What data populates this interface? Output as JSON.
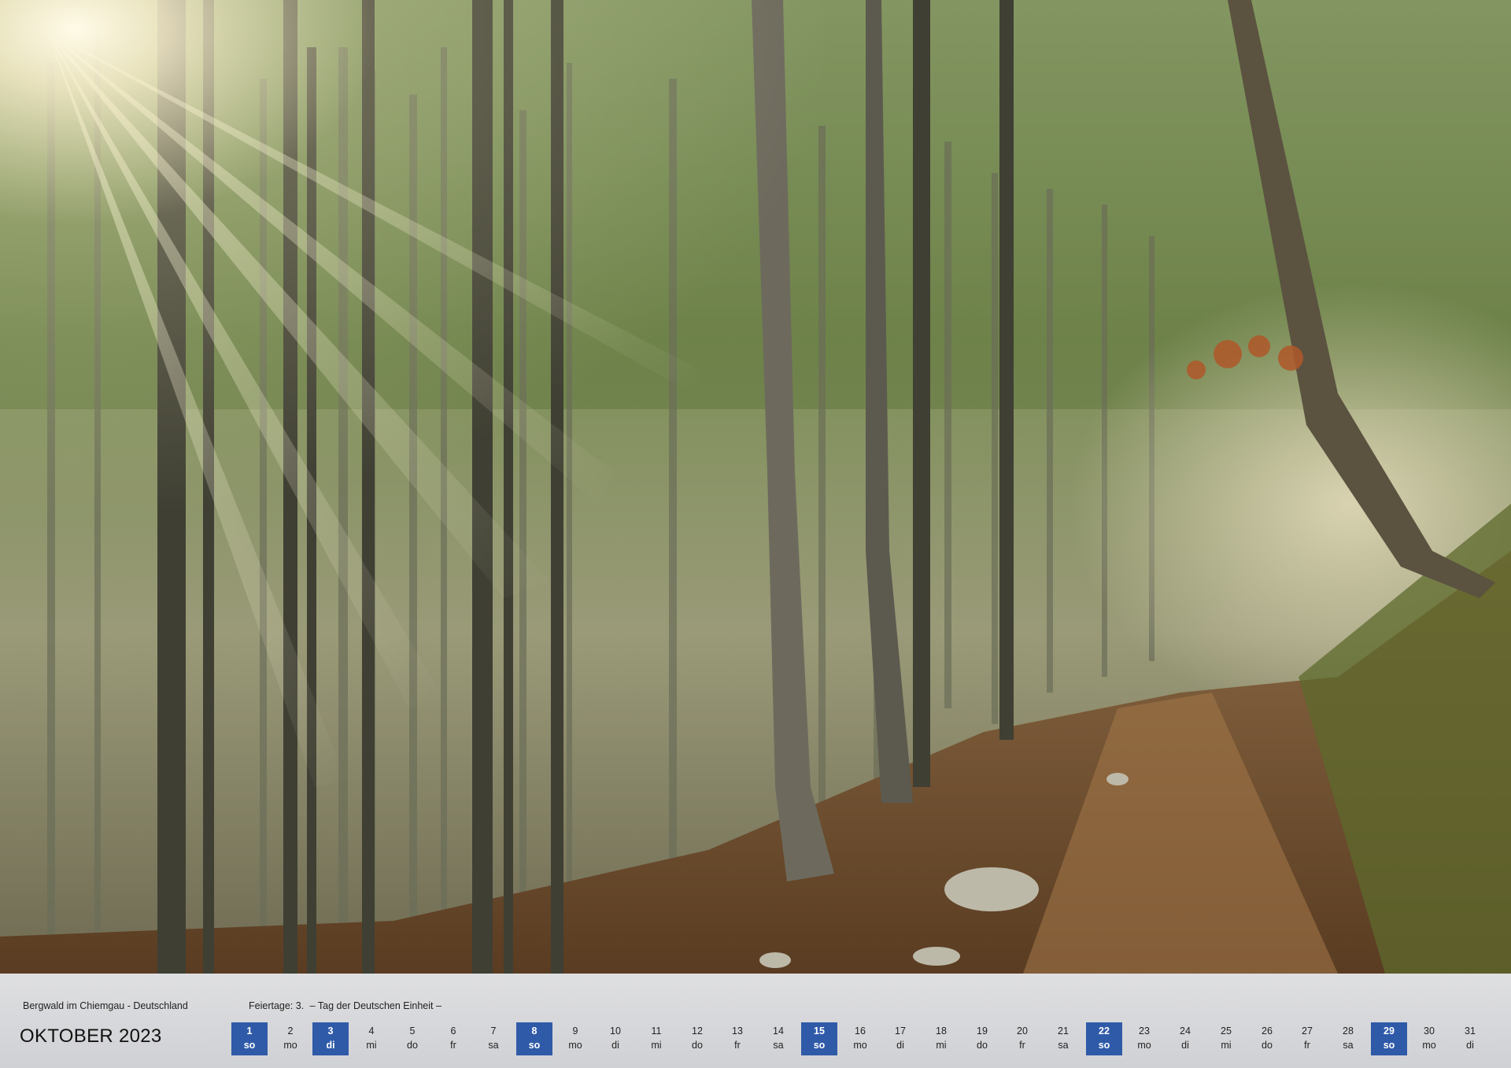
{
  "photo": {
    "subject": "misty mountain forest with sunbeams and leaf-covered path"
  },
  "caption": "Bergwald im Chiemgau - Deutschland",
  "holidays": {
    "label": "Feiertage: 3.",
    "text": "– Tag der Deutschen Einheit –"
  },
  "month_title": "OKTOBER 2023",
  "colors": {
    "sunday_highlight": "#2f5aa8",
    "strip_background": "#e6e6eb"
  },
  "days": [
    {
      "n": "1",
      "w": "so",
      "sun": true
    },
    {
      "n": "2",
      "w": "mo",
      "sun": false
    },
    {
      "n": "3",
      "w": "di",
      "sun": true
    },
    {
      "n": "4",
      "w": "mi",
      "sun": false
    },
    {
      "n": "5",
      "w": "do",
      "sun": false
    },
    {
      "n": "6",
      "w": "fr",
      "sun": false
    },
    {
      "n": "7",
      "w": "sa",
      "sun": false
    },
    {
      "n": "8",
      "w": "so",
      "sun": true
    },
    {
      "n": "9",
      "w": "mo",
      "sun": false
    },
    {
      "n": "10",
      "w": "di",
      "sun": false
    },
    {
      "n": "11",
      "w": "mi",
      "sun": false
    },
    {
      "n": "12",
      "w": "do",
      "sun": false
    },
    {
      "n": "13",
      "w": "fr",
      "sun": false
    },
    {
      "n": "14",
      "w": "sa",
      "sun": false
    },
    {
      "n": "15",
      "w": "so",
      "sun": true
    },
    {
      "n": "16",
      "w": "mo",
      "sun": false
    },
    {
      "n": "17",
      "w": "di",
      "sun": false
    },
    {
      "n": "18",
      "w": "mi",
      "sun": false
    },
    {
      "n": "19",
      "w": "do",
      "sun": false
    },
    {
      "n": "20",
      "w": "fr",
      "sun": false
    },
    {
      "n": "21",
      "w": "sa",
      "sun": false
    },
    {
      "n": "22",
      "w": "so",
      "sun": true
    },
    {
      "n": "23",
      "w": "mo",
      "sun": false
    },
    {
      "n": "24",
      "w": "di",
      "sun": false
    },
    {
      "n": "25",
      "w": "mi",
      "sun": false
    },
    {
      "n": "26",
      "w": "do",
      "sun": false
    },
    {
      "n": "27",
      "w": "fr",
      "sun": false
    },
    {
      "n": "28",
      "w": "sa",
      "sun": false
    },
    {
      "n": "29",
      "w": "so",
      "sun": true
    },
    {
      "n": "30",
      "w": "mo",
      "sun": false
    },
    {
      "n": "31",
      "w": "di",
      "sun": false
    }
  ]
}
